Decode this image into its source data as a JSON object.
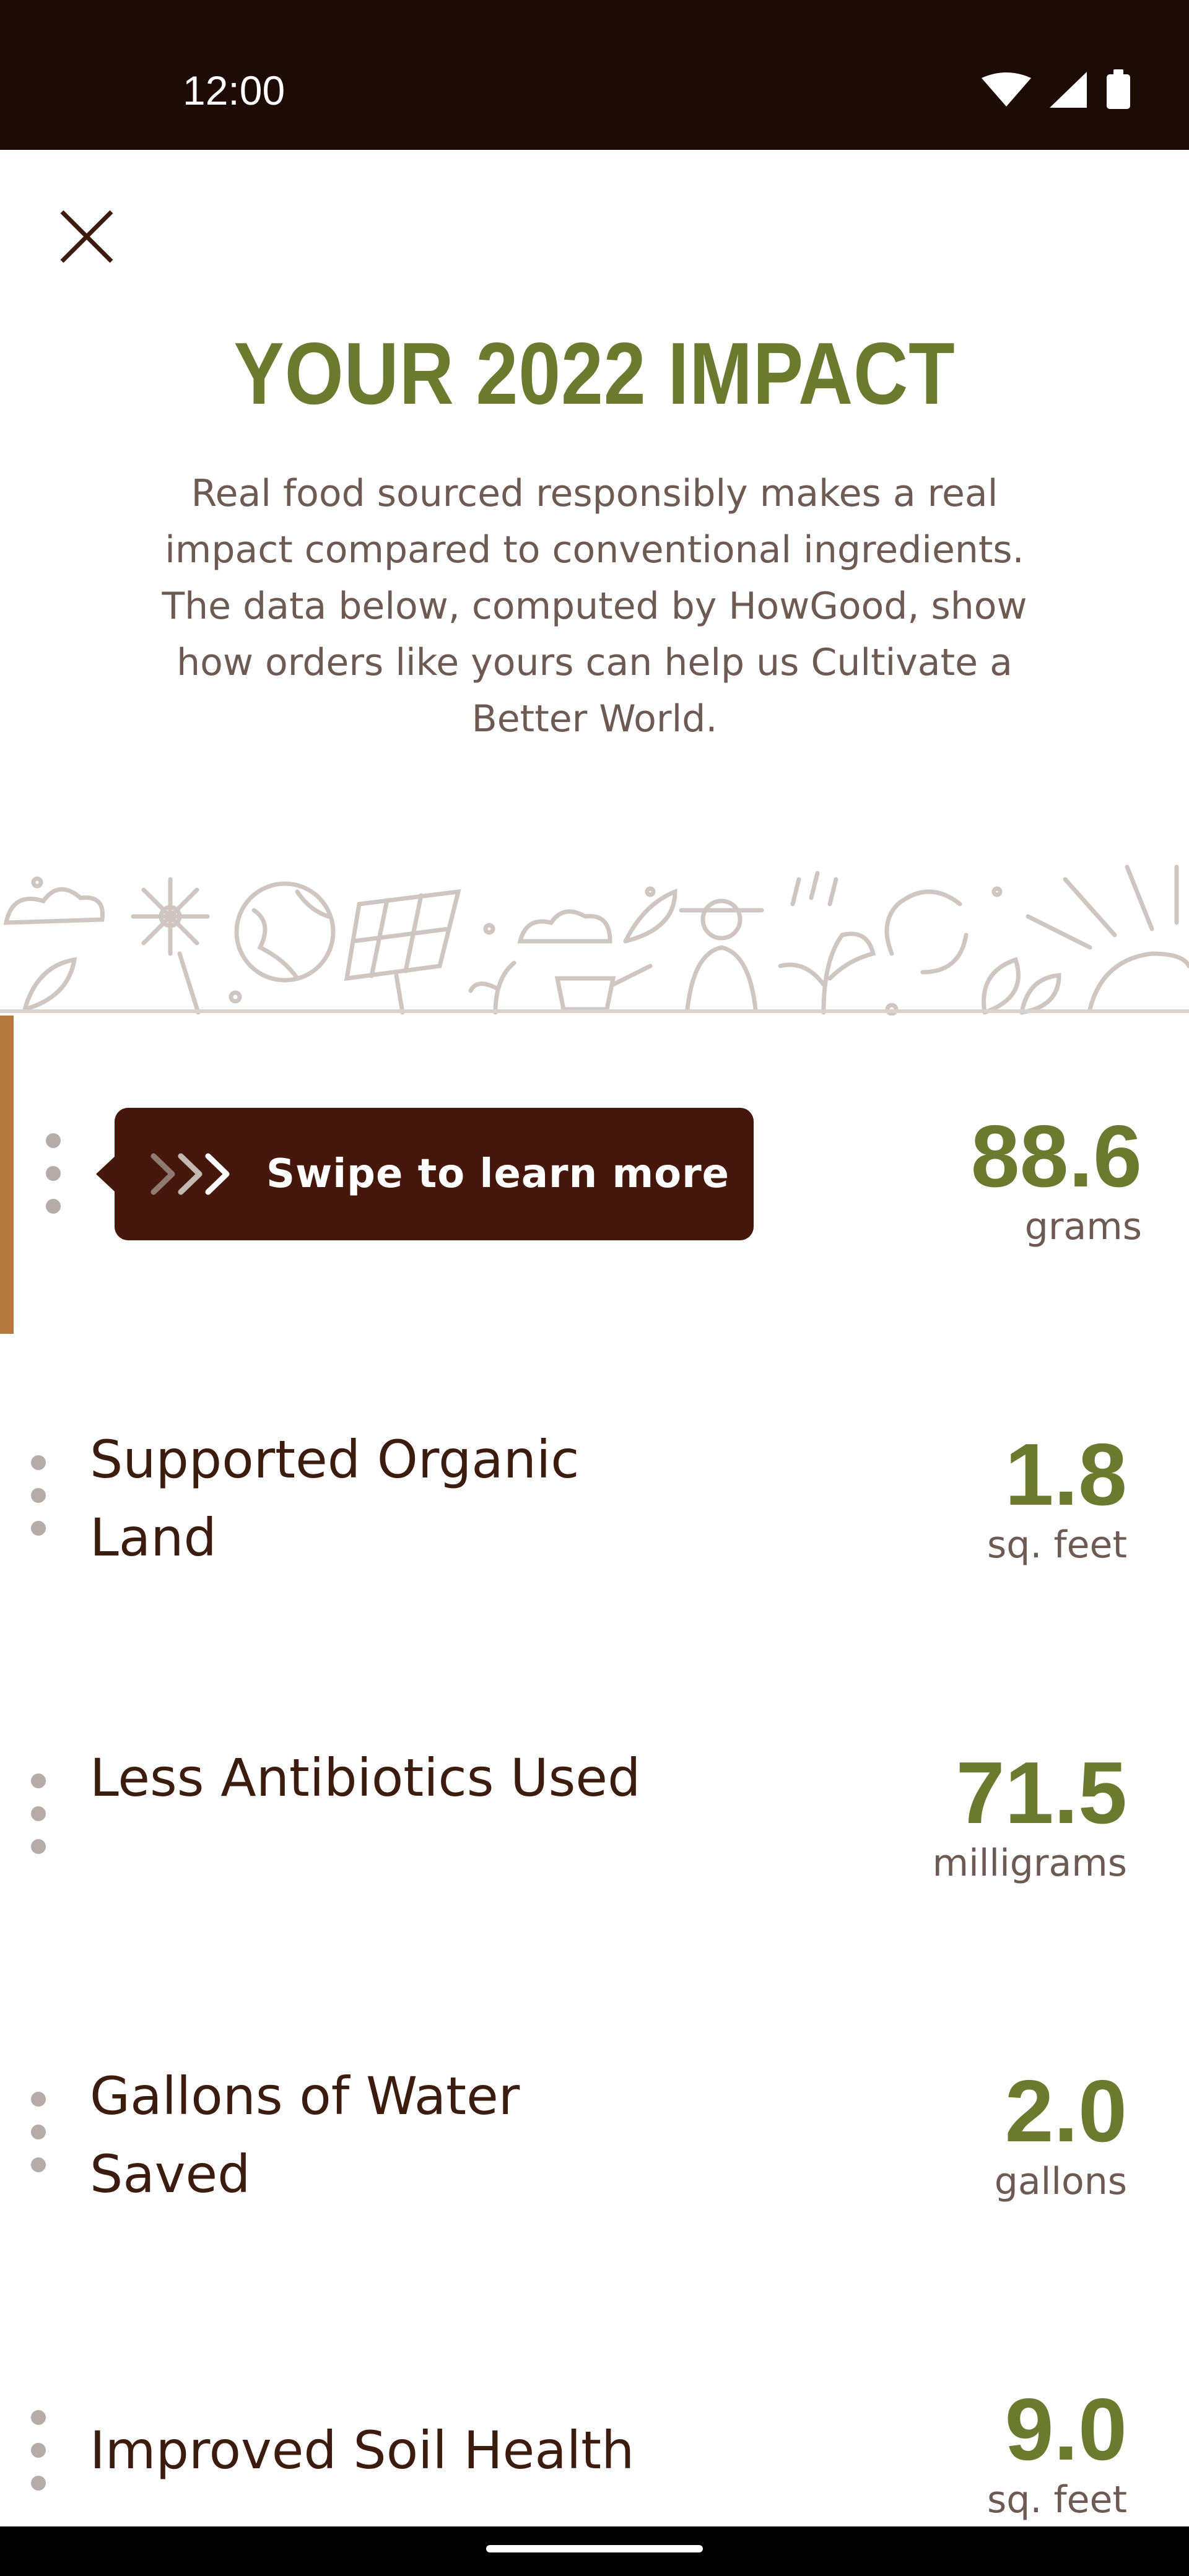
{
  "status_bar": {
    "time": "12:00"
  },
  "header": {
    "close_icon": "close-icon",
    "title": "YOUR 2022 IMPACT",
    "intro": "Real food sourced responsibly makes a real impact compared to conventional ingredients. The data below, computed by HowGood, show how orders like yours can help us Cultivate a Better World."
  },
  "tooltip": {
    "icon": "chevrons-right-icon",
    "text": "Swipe to learn more"
  },
  "impact_items": [
    {
      "label": "",
      "value": "88.6",
      "unit": "grams"
    },
    {
      "label": "Supported Organic Land",
      "value": "1.8",
      "unit": "sq. feet"
    },
    {
      "label": "Less Antibiotics Used",
      "value": "71.5",
      "unit": "milligrams"
    },
    {
      "label": "Gallons of Water Saved",
      "value": "2.0",
      "unit": "gallons"
    },
    {
      "label": "Improved Soil Health",
      "value": "9.0",
      "unit": "sq. feet"
    }
  ],
  "colors": {
    "accent_green": "#6b7a2e",
    "brown_dark": "#3d1c10",
    "tooltip_bg": "#45180b",
    "row_accent": "#b27a3c"
  }
}
